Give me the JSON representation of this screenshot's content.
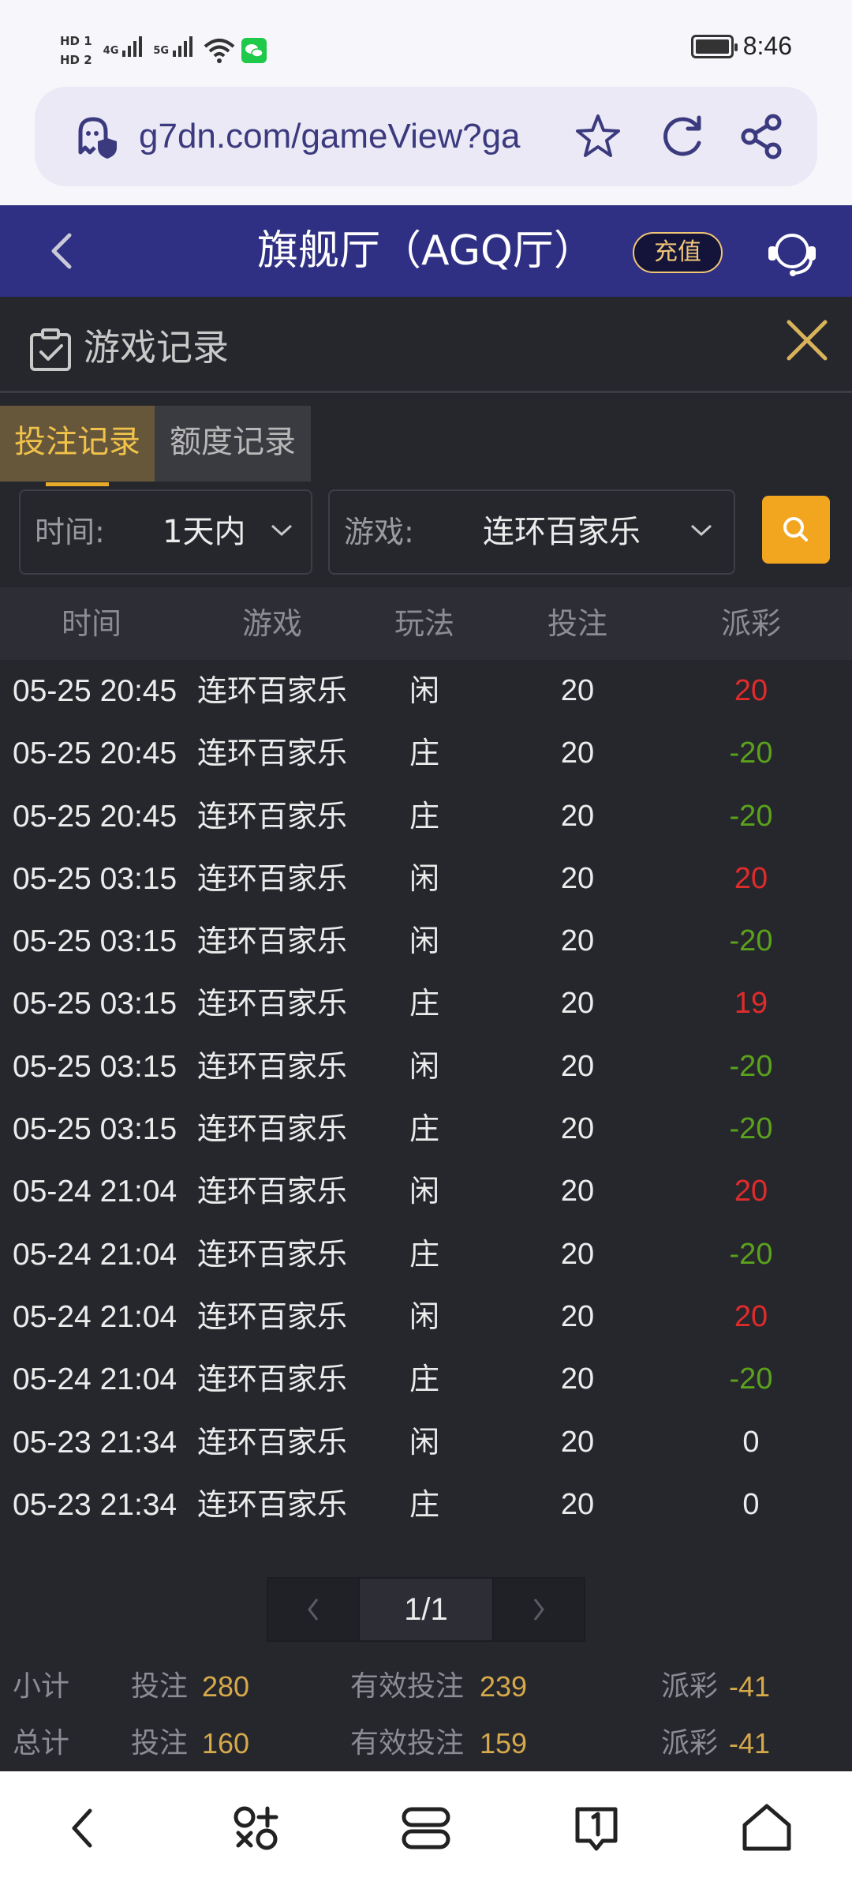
{
  "status_bar": {
    "sim1": "HD 1",
    "sim2": "HD 2",
    "net1": "4G",
    "net2": "5G",
    "time": "8:46",
    "battery_level": 0.95
  },
  "browser": {
    "url": "g7dn.com/gameView?ga"
  },
  "header": {
    "title": "旗舰厅（AGQ厅）",
    "recharge_label": "充值"
  },
  "panel": {
    "title": "游戏记录",
    "tabs": [
      {
        "label": "投注记录",
        "active": true
      },
      {
        "label": "额度记录",
        "active": false
      }
    ],
    "filters": {
      "time_label": "时间:",
      "time_value": "1天内",
      "game_label": "游戏:",
      "game_value": "连环百家乐"
    },
    "columns": [
      "时间",
      "游戏",
      "玩法",
      "投注",
      "派彩"
    ],
    "rows": [
      {
        "time": "05-25 20:45",
        "game": "连环百家乐",
        "play": "闲",
        "bet": "20",
        "payout": "20",
        "type": "pos"
      },
      {
        "time": "05-25 20:45",
        "game": "连环百家乐",
        "play": "庄",
        "bet": "20",
        "payout": "-20",
        "type": "neg"
      },
      {
        "time": "05-25 20:45",
        "game": "连环百家乐",
        "play": "庄",
        "bet": "20",
        "payout": "-20",
        "type": "neg"
      },
      {
        "time": "05-25 03:15",
        "game": "连环百家乐",
        "play": "闲",
        "bet": "20",
        "payout": "20",
        "type": "pos"
      },
      {
        "time": "05-25 03:15",
        "game": "连环百家乐",
        "play": "闲",
        "bet": "20",
        "payout": "-20",
        "type": "neg"
      },
      {
        "time": "05-25 03:15",
        "game": "连环百家乐",
        "play": "庄",
        "bet": "20",
        "payout": "19",
        "type": "pos"
      },
      {
        "time": "05-25 03:15",
        "game": "连环百家乐",
        "play": "闲",
        "bet": "20",
        "payout": "-20",
        "type": "neg"
      },
      {
        "time": "05-25 03:15",
        "game": "连环百家乐",
        "play": "庄",
        "bet": "20",
        "payout": "-20",
        "type": "neg"
      },
      {
        "time": "05-24 21:04",
        "game": "连环百家乐",
        "play": "闲",
        "bet": "20",
        "payout": "20",
        "type": "pos"
      },
      {
        "time": "05-24 21:04",
        "game": "连环百家乐",
        "play": "庄",
        "bet": "20",
        "payout": "-20",
        "type": "neg"
      },
      {
        "time": "05-24 21:04",
        "game": "连环百家乐",
        "play": "闲",
        "bet": "20",
        "payout": "20",
        "type": "pos"
      },
      {
        "time": "05-24 21:04",
        "game": "连环百家乐",
        "play": "庄",
        "bet": "20",
        "payout": "-20",
        "type": "neg"
      },
      {
        "time": "05-23 21:34",
        "game": "连环百家乐",
        "play": "闲",
        "bet": "20",
        "payout": "0",
        "type": "zero"
      },
      {
        "time": "05-23 21:34",
        "game": "连环百家乐",
        "play": "庄",
        "bet": "20",
        "payout": "0",
        "type": "zero"
      }
    ],
    "pagination": {
      "page": "1/1"
    },
    "subtotal": {
      "label": "小计",
      "bet_label": "投注",
      "bet": "280",
      "valid_label": "有效投注",
      "valid": "239",
      "payout_label": "派彩",
      "payout": "-41"
    },
    "total": {
      "label": "总计",
      "bet_label": "投注",
      "bet": "160",
      "valid_label": "有效投注",
      "valid": "159",
      "payout_label": "派彩",
      "payout": "-41"
    }
  },
  "icons": [
    "shield-lock-icon",
    "star-icon",
    "refresh-icon",
    "share-icon",
    "back-icon",
    "headset-icon",
    "clipboard-check-icon",
    "close-icon",
    "chevron-down-icon",
    "search-icon",
    "chevron-left-icon",
    "chevron-right-icon",
    "nav-back-icon",
    "apps-icon",
    "tabs-icon",
    "badge-one-icon",
    "home-icon"
  ],
  "colors": {
    "header_bg": "#2f2f84",
    "panel_bg": "#26272d",
    "accent_gold": "#f1c24a",
    "positive": "#e02b2b",
    "negative": "#5aa21c"
  }
}
